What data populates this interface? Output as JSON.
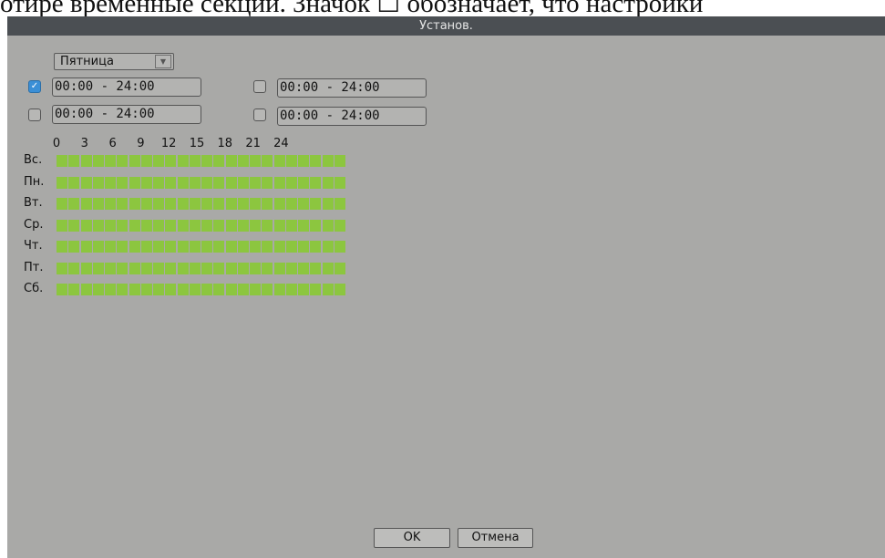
{
  "background_text": "отире временные секции. Значок ☐ обозначает, что настройки",
  "dialog": {
    "title": "Установ."
  },
  "day_select": {
    "value": "Пятница",
    "arrow_icon": "▼"
  },
  "periods": [
    {
      "checked": true,
      "value": "00:00  -  24:00"
    },
    {
      "checked": false,
      "value": "00:00  -  24:00"
    },
    {
      "checked": false,
      "value": "00:00  -  24:00"
    },
    {
      "checked": false,
      "value": "00:00  -  24:00"
    }
  ],
  "hours": [
    "0",
    "3",
    "6",
    "9",
    "12",
    "15",
    "18",
    "21",
    "24"
  ],
  "days": [
    "Вс.",
    "Пн.",
    "Вт.",
    "Ср.",
    "Чт.",
    "Пт.",
    "Сб."
  ],
  "schedule_color": "#8cc63f",
  "buttons": {
    "ok": "OK",
    "cancel": "Отмена"
  }
}
